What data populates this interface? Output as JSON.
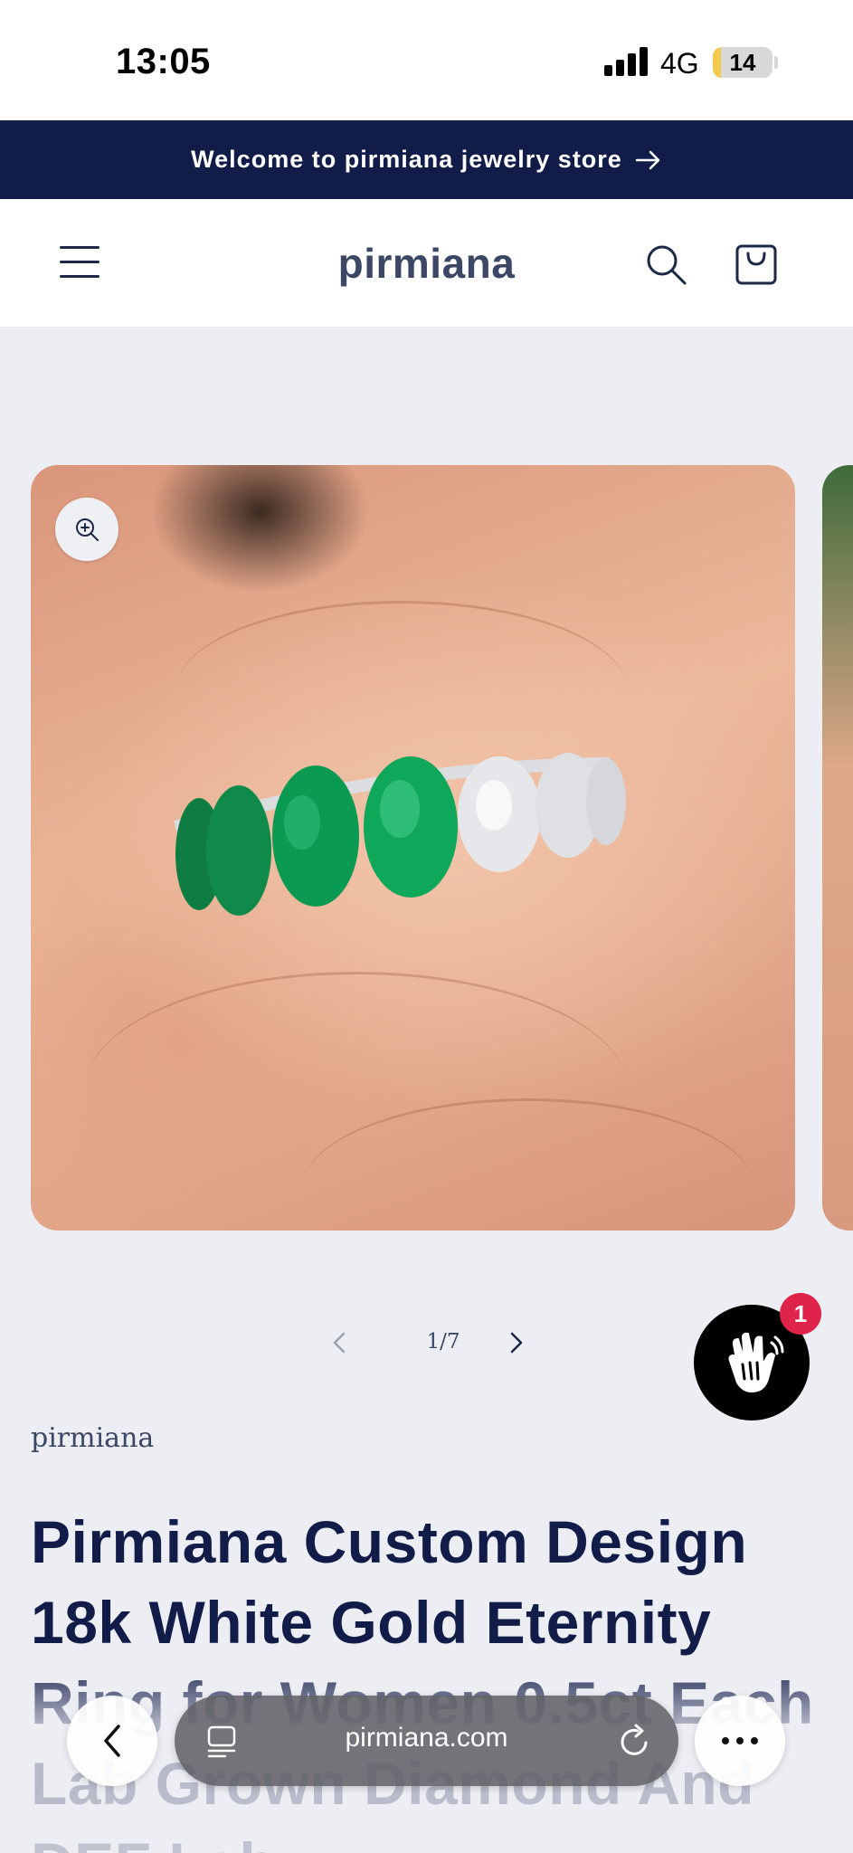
{
  "status_bar": {
    "time": "13:05",
    "network": "4G",
    "battery_level": "14",
    "battery_fraction": 0.14
  },
  "announcement": {
    "text": "Welcome to pirmiana jewelry store",
    "icon": "arrow-right-icon"
  },
  "header": {
    "brand": "pirmiana",
    "menu_icon": "hamburger-menu-icon",
    "search_icon": "search-icon",
    "cart_icon": "cart-icon"
  },
  "gallery": {
    "zoom_icon": "zoom-in-icon",
    "pager": "1/7",
    "current": 1,
    "total": 7
  },
  "chat": {
    "icon": "waving-hand-icon",
    "badge": "1"
  },
  "product": {
    "vendor": "pirmiana",
    "title": "Pirmiana Custom Design 18k White Gold Eternity Ring for Women 0.5ct Each Lab Grown Diamond And DEF Lab"
  },
  "browser": {
    "url": "pirmiana.com",
    "back_icon": "chevron-left-icon",
    "tabs_icon": "tabs-icon",
    "reload_icon": "reload-icon",
    "more_icon": "more-dots-icon"
  },
  "colors": {
    "navy": "#121c48",
    "brand_text": "#3c4766",
    "page_bg": "#eceef3",
    "badge_red": "#e0234a",
    "emerald": "#0f8a4a"
  }
}
